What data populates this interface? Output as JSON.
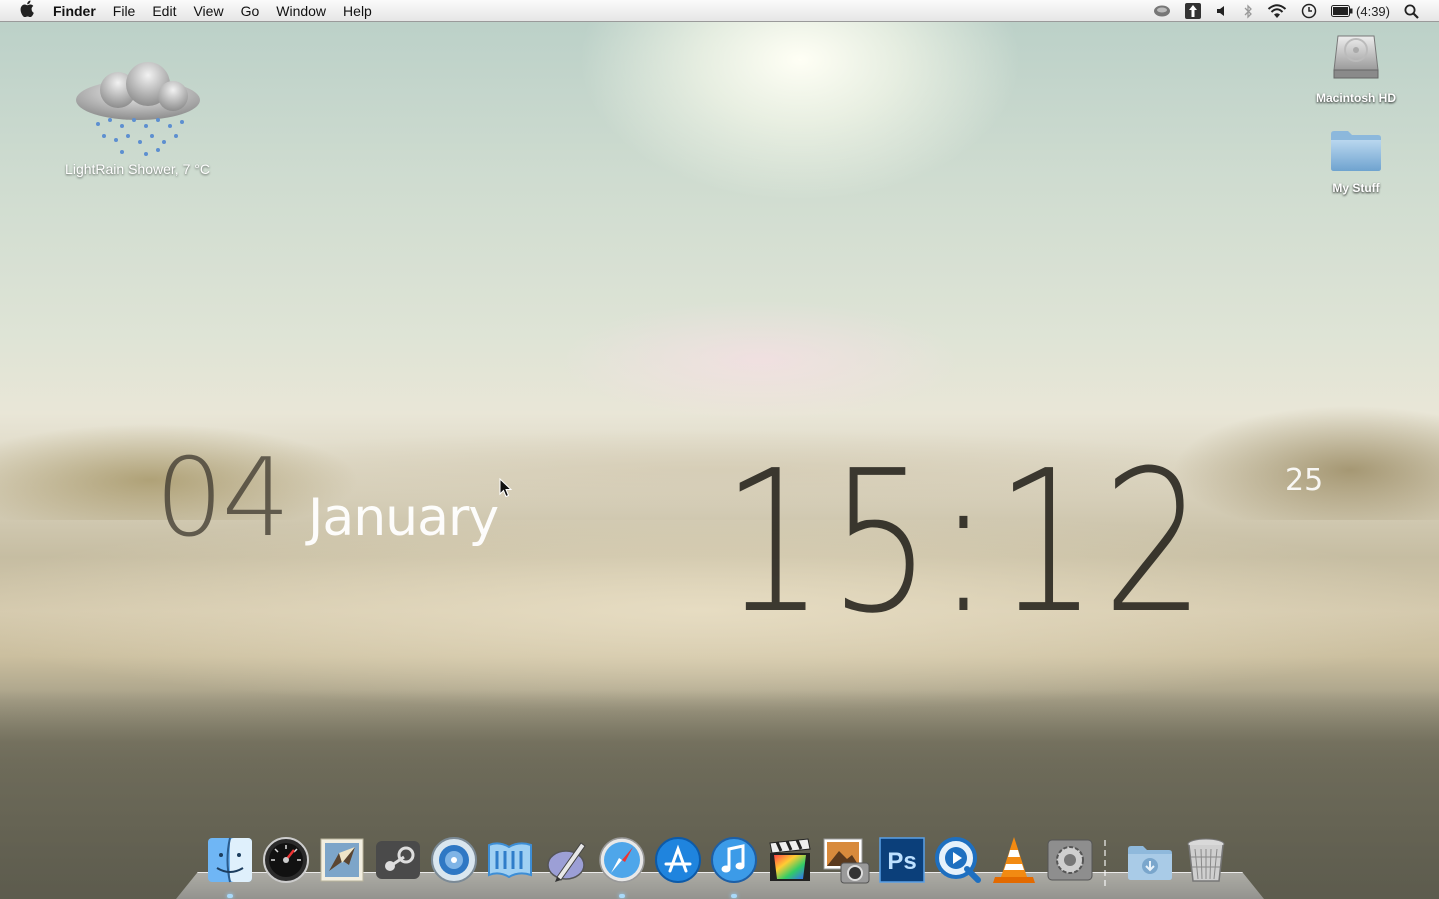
{
  "menubar": {
    "app_name": "Finder",
    "items": [
      "File",
      "Edit",
      "View",
      "Go",
      "Window",
      "Help"
    ],
    "status": {
      "battery_text": "(4:39)"
    }
  },
  "desktop": {
    "icons": [
      {
        "label": "Macintosh HD",
        "icon": "hard-drive-icon"
      },
      {
        "label": "My Stuff",
        "icon": "folder-icon"
      }
    ]
  },
  "weather": {
    "label": "LightRain Shower, 7 °C",
    "icon": "rain-cloud-icon"
  },
  "clock": {
    "day": "04",
    "month": "January",
    "time": "15:12",
    "seconds": "25"
  },
  "dock": {
    "items": [
      {
        "name": "finder",
        "icon": "finder-icon",
        "running": true
      },
      {
        "name": "dashboard",
        "icon": "dashboard-icon",
        "running": false
      },
      {
        "name": "mail",
        "icon": "mail-icon",
        "running": false
      },
      {
        "name": "steam",
        "icon": "steam-icon",
        "running": false
      },
      {
        "name": "system-preferences-alt",
        "icon": "gear-disc-icon",
        "running": false
      },
      {
        "name": "word",
        "icon": "word-icon",
        "running": false
      },
      {
        "name": "script-editor",
        "icon": "pen-icon",
        "running": false
      },
      {
        "name": "safari",
        "icon": "compass-icon",
        "running": true
      },
      {
        "name": "app-store",
        "icon": "app-store-icon",
        "running": false
      },
      {
        "name": "itunes",
        "icon": "music-note-icon",
        "running": true
      },
      {
        "name": "final-cut",
        "icon": "clapper-icon",
        "running": false
      },
      {
        "name": "iphoto",
        "icon": "photo-camera-icon",
        "running": false
      },
      {
        "name": "photoshop",
        "icon": "photoshop-icon",
        "label": "Ps",
        "running": false
      },
      {
        "name": "quicktime",
        "icon": "quicktime-icon",
        "running": false
      },
      {
        "name": "vlc",
        "icon": "traffic-cone-icon",
        "running": false
      },
      {
        "name": "system-preferences",
        "icon": "gear-icon",
        "running": false
      },
      {
        "name": "downloads",
        "icon": "downloads-folder-icon",
        "running": false
      },
      {
        "name": "trash",
        "icon": "trash-icon",
        "running": false
      }
    ]
  }
}
